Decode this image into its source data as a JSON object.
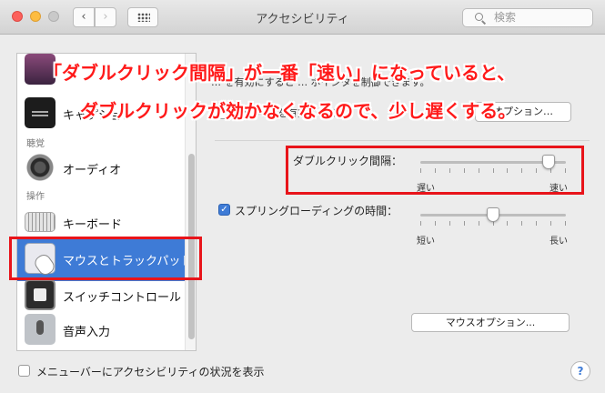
{
  "window": {
    "title": "アクセシビリティ"
  },
  "toolbar": {
    "back": "‹",
    "forward": "›"
  },
  "search": {
    "placeholder": "検索"
  },
  "sidebar": {
    "items": [
      {
        "label": "",
        "icon": "display-icon"
      },
      {
        "label": "キャプション",
        "icon": "caption-icon"
      },
      {
        "label": "オーディオ",
        "icon": "speaker-icon"
      },
      {
        "label": "キーボード",
        "icon": "keyboard-icon"
      },
      {
        "label": "マウスとトラックパッド",
        "icon": "mouse-icon"
      },
      {
        "label": "スイッチコントロール",
        "icon": "switch-control-icon"
      },
      {
        "label": "音声入力",
        "icon": "microphone-icon"
      }
    ],
    "headers": {
      "hearing": "聴覚",
      "interaction": "操作"
    }
  },
  "main": {
    "hint_line1": "… を有効にすると … ポインタを制御できます。",
    "hint_line2": "マウスキーを有効にする",
    "options_button": "オプション…",
    "double_click": {
      "label": "ダブルクリック間隔：",
      "min_label": "遅い",
      "max_label": "速い",
      "value_fraction": 0.88
    },
    "spring_loading": {
      "label": "スプリングローディングの時間：",
      "checked": true,
      "min_label": "短い",
      "max_label": "長い",
      "value_fraction": 0.5
    },
    "mouse_options_button": "マウスオプション..."
  },
  "footer": {
    "menu_bar_status": "メニューバーにアクセシビリティの状況を表示",
    "help": "?"
  },
  "annotation": {
    "line1": "「ダブルクリック間隔」が一番「速い」になっていると、",
    "line2": "ダブルクリックが効かなくなるので、少し遅くする。",
    "color": "#ff1a1a"
  }
}
